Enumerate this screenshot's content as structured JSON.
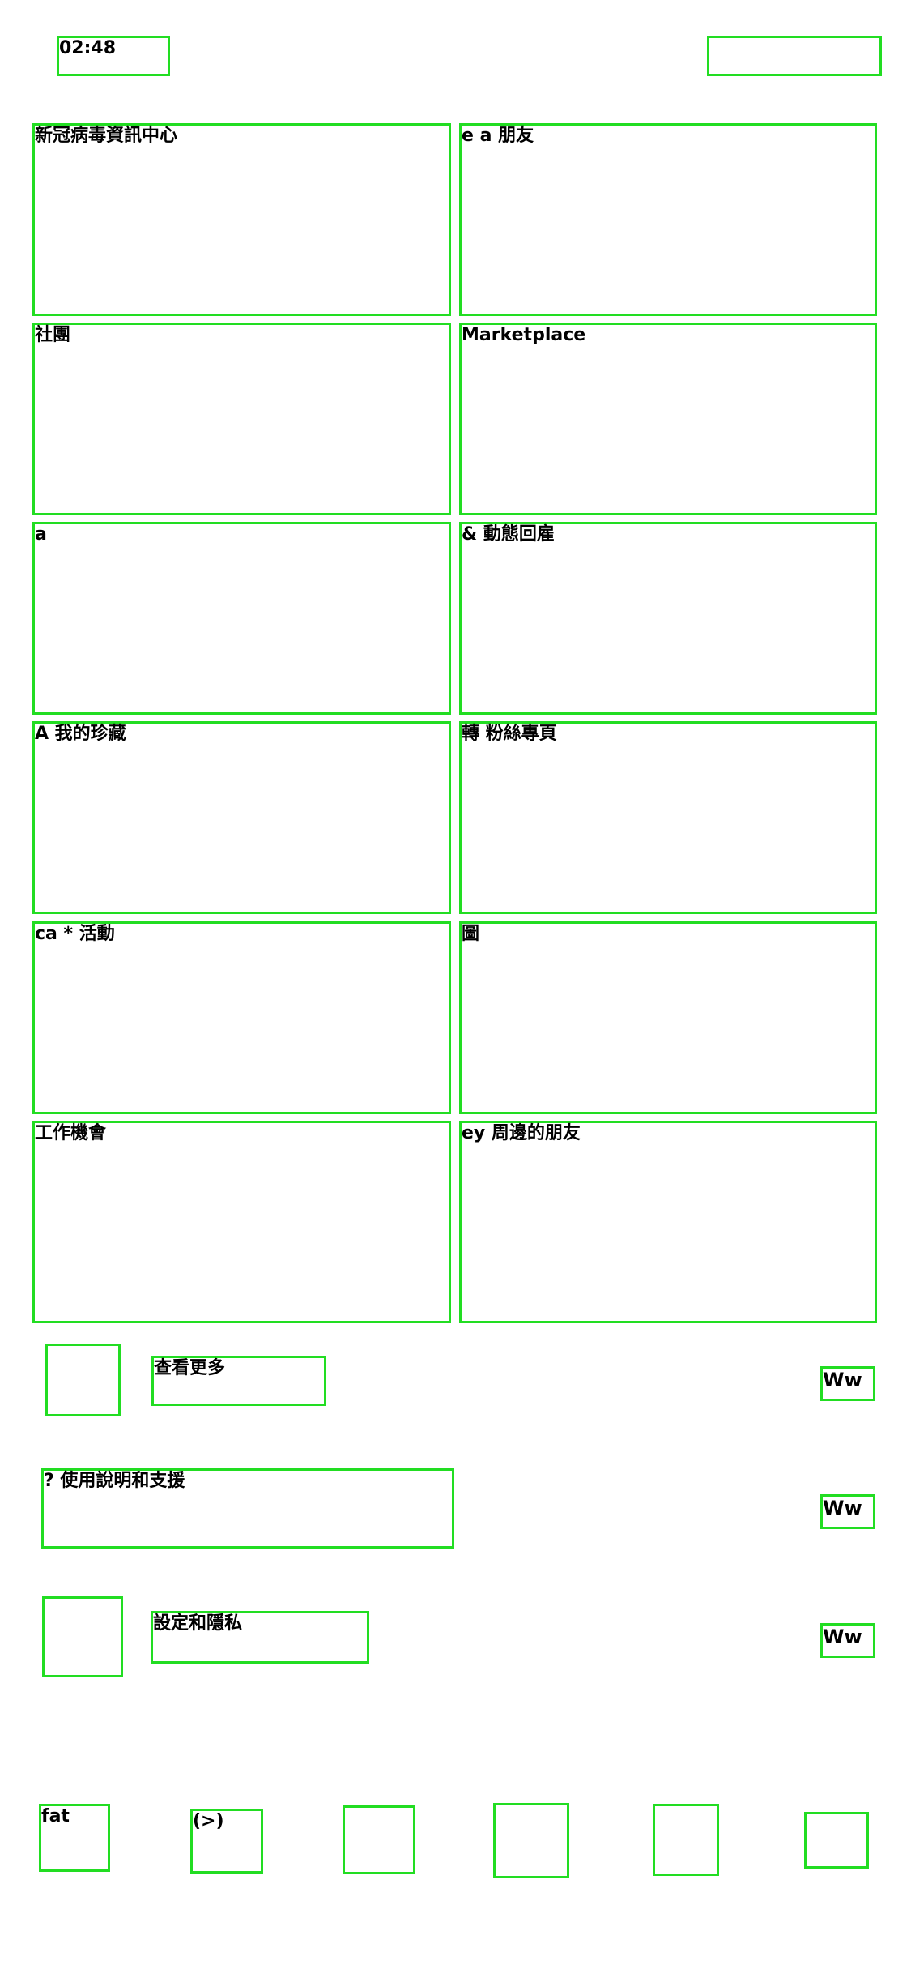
{
  "status_bar": {
    "time": "02:48"
  },
  "tiles": [
    {
      "id": "covid-info-center",
      "label": "新冠病毒資訊中心"
    },
    {
      "id": "friends",
      "label": "e a 朋友"
    },
    {
      "id": "groups",
      "label": "社團"
    },
    {
      "id": "marketplace",
      "label": "Marketplace"
    },
    {
      "id": "watch",
      "label": "a"
    },
    {
      "id": "memories",
      "label": "& 動態回雇"
    },
    {
      "id": "saved",
      "label": "A 我的珍藏"
    },
    {
      "id": "pages",
      "label": "轉 粉絲專頁"
    },
    {
      "id": "events",
      "label": "ca * 活動"
    },
    {
      "id": "gaming",
      "label": "圖"
    },
    {
      "id": "jobs",
      "label": "工作機會"
    },
    {
      "id": "nearby-friends",
      "label": "ey 周邊的朋友"
    }
  ],
  "rows": [
    {
      "id": "see-more",
      "label": "查看更多",
      "chevron": "Ww"
    },
    {
      "id": "help-support",
      "label": "? 使用說明和支援",
      "chevron": "Ww"
    },
    {
      "id": "settings-privacy",
      "label": "設定和隱私",
      "chevron": "Ww"
    }
  ],
  "bottom_nav": [
    {
      "id": "home",
      "label": "fat"
    },
    {
      "id": "watch",
      "label": "(>)"
    }
  ],
  "colors": {
    "outline": "#22dd22"
  }
}
